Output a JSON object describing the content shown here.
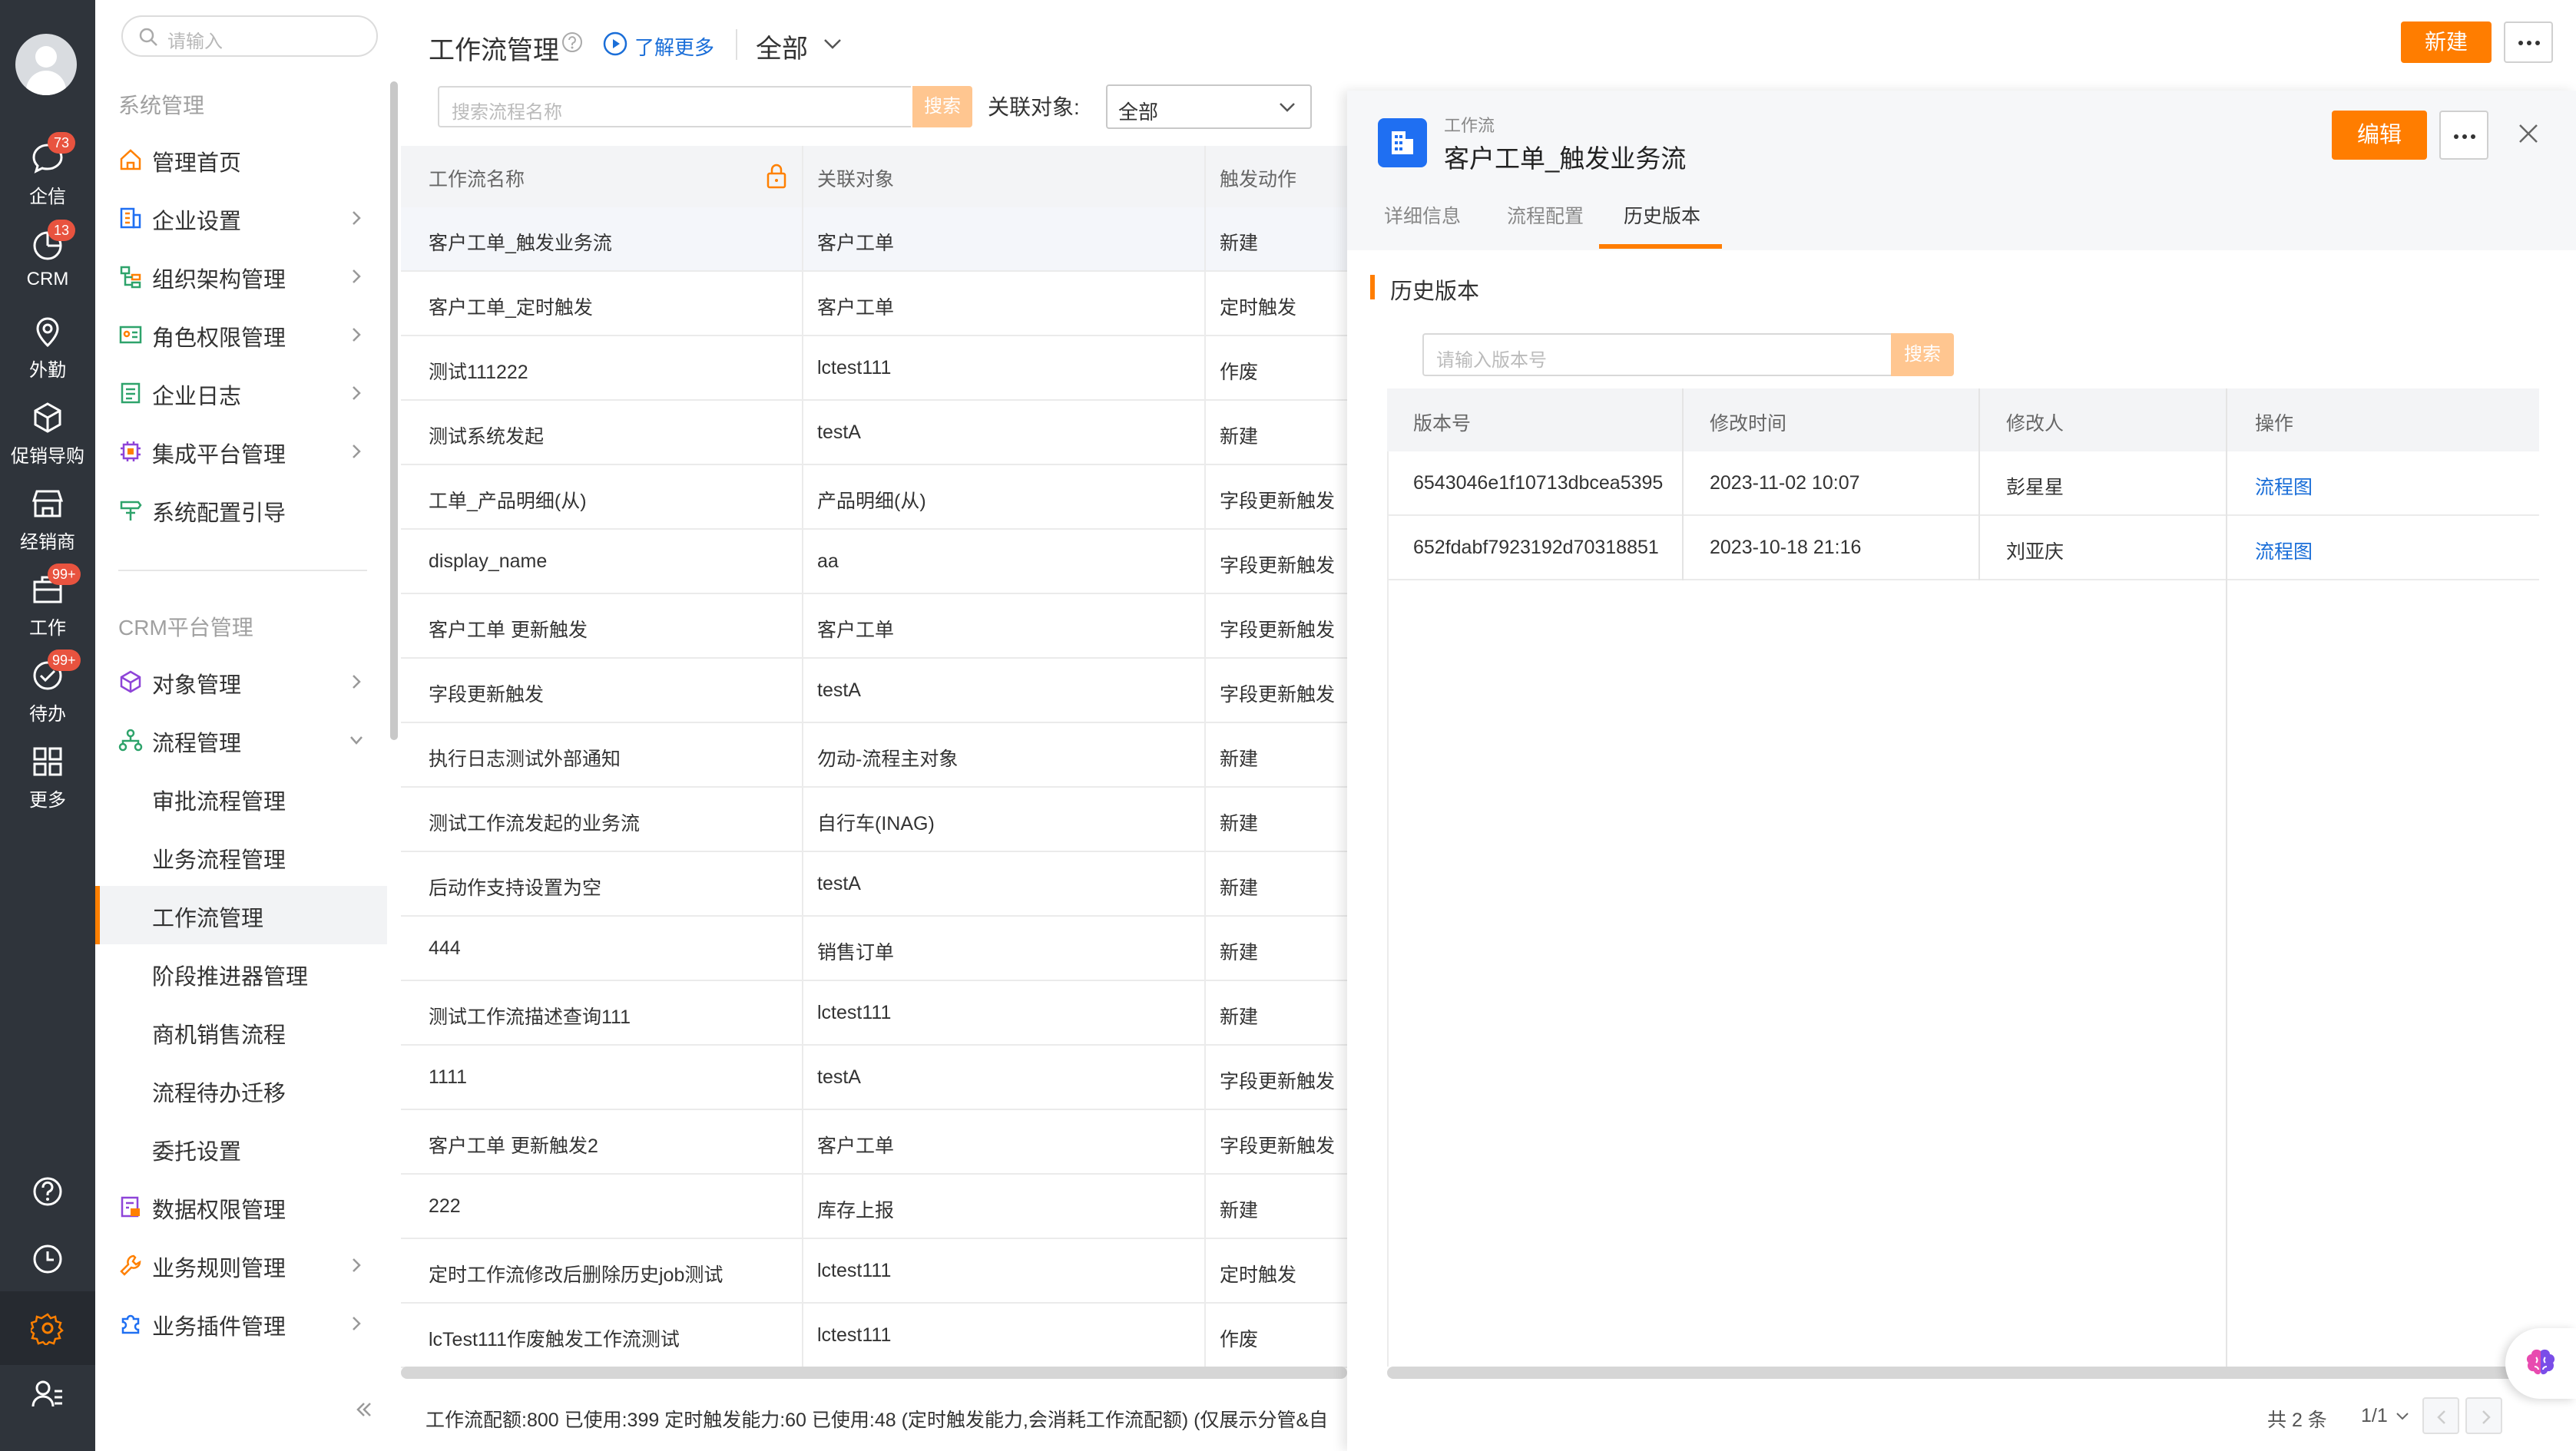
{
  "nav": {
    "items": [
      {
        "label": "企信",
        "badge": "73",
        "icon": "chat-icon"
      },
      {
        "label": "CRM",
        "badge": "13",
        "icon": "crm-icon"
      },
      {
        "label": "外勤",
        "badge": "",
        "icon": "location-icon"
      },
      {
        "label": "促销导购",
        "badge": "",
        "icon": "cube-icon"
      },
      {
        "label": "经销商",
        "badge": "",
        "icon": "store-icon"
      },
      {
        "label": "工作",
        "badge": "99+",
        "icon": "briefcase-icon"
      },
      {
        "label": "待办",
        "badge": "99+",
        "icon": "check-circle-icon"
      },
      {
        "label": "更多",
        "badge": "",
        "icon": "grid-icon"
      }
    ],
    "bottom": [
      "help-icon",
      "clock-icon",
      "gear-icon",
      "user-list-icon"
    ]
  },
  "sidebar": {
    "search_placeholder": "请输入",
    "group1": "系统管理",
    "group1_items": [
      "管理首页",
      "企业设置",
      "组织架构管理",
      "角色权限管理",
      "企业日志",
      "集成平台管理",
      "系统配置引导"
    ],
    "group2": "CRM平台管理",
    "group2_items": [
      "对象管理",
      "流程管理"
    ],
    "flow_sub": [
      "审批流程管理",
      "业务流程管理",
      "工作流管理",
      "阶段推进器管理",
      "商机销售流程",
      "流程待办迁移",
      "委托设置"
    ],
    "tail_items": [
      "数据权限管理",
      "业务规则管理",
      "业务插件管理"
    ]
  },
  "header": {
    "title": "工作流管理",
    "learn_more": "了解更多",
    "scope": "全部",
    "new_button": "新建"
  },
  "filter": {
    "search_placeholder": "搜索流程名称",
    "search_button": "搜索",
    "related_label": "关联对象:",
    "related_value": "全部"
  },
  "table": {
    "columns": [
      "工作流名称",
      "关联对象",
      "触发动作"
    ],
    "rows": [
      [
        "客户工单_触发业务流",
        "客户工单",
        "新建"
      ],
      [
        "客户工单_定时触发",
        "客户工单",
        "定时触发"
      ],
      [
        "测试111222",
        "lctest111",
        "作废"
      ],
      [
        "测试系统发起",
        "testA",
        "新建"
      ],
      [
        "工单_产品明细(从)",
        "产品明细(从)",
        "字段更新触发"
      ],
      [
        "display_name",
        "aa",
        "字段更新触发"
      ],
      [
        "客户工单 更新触发",
        "客户工单",
        "字段更新触发"
      ],
      [
        "字段更新触发",
        "testA",
        "字段更新触发"
      ],
      [
        "执行日志测试外部通知",
        "勿动-流程主对象",
        "新建"
      ],
      [
        "测试工作流发起的业务流",
        "自行车(INAG)",
        "新建"
      ],
      [
        "后动作支持设置为空",
        "testA",
        "新建"
      ],
      [
        "444",
        "销售订单",
        "新建"
      ],
      [
        "测试工作流描述查询111",
        "lctest111",
        "新建"
      ],
      [
        "1111",
        "testA",
        "字段更新触发"
      ],
      [
        "客户工单 更新触发2",
        "客户工单",
        "字段更新触发"
      ],
      [
        "222",
        "库存上报",
        "新建"
      ],
      [
        "定时工作流修改后删除历史job测试",
        "lctest111",
        "定时触发"
      ],
      [
        "lcTest111作废触发工作流测试",
        "lctest111",
        "作废"
      ]
    ],
    "footer": "工作流配额:800  已使用:399  定时触发能力:60  已使用:48  (定时触发能力,会消耗工作流配额)  (仅展示分管&自"
  },
  "drawer": {
    "kind": "工作流",
    "name": "客户工单_触发业务流",
    "edit_button": "编辑",
    "tabs": [
      "详细信息",
      "流程配置",
      "历史版本"
    ],
    "active_tab": "历史版本",
    "section_title": "历史版本",
    "version_placeholder": "请输入版本号",
    "version_search_button": "搜索",
    "columns": [
      "版本号",
      "修改时间",
      "修改人",
      "操作"
    ],
    "rows": [
      [
        "6543046e1f10713dbcea5395",
        "2023-11-02 10:07",
        "彭星星",
        "流程图"
      ],
      [
        "652fdabf7923192d70318851",
        "2023-10-18 21:16",
        "刘亚庆",
        "流程图"
      ]
    ],
    "pagination_total": "共 2 条",
    "pagination_page": "1/1"
  },
  "colors": {
    "accent": "#ff7d00",
    "nav_bg": "#2f343b",
    "link": "#1a6ed8",
    "badge": "#e8533f"
  }
}
